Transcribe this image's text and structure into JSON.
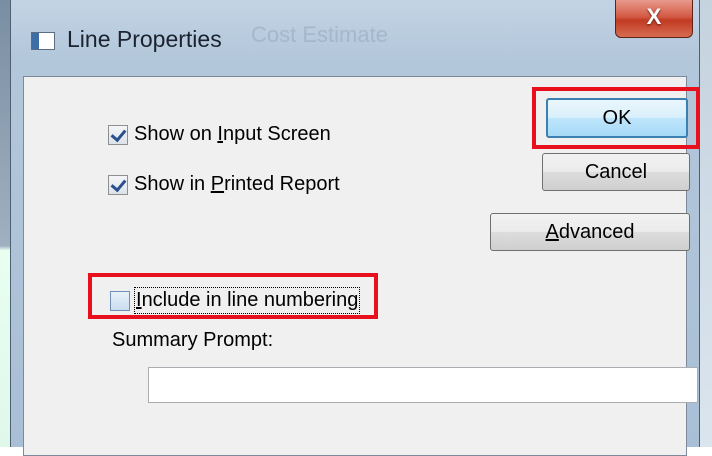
{
  "window": {
    "title": "Line Properties",
    "background_title": "Cost Estimate",
    "close_glyph": "X"
  },
  "checkboxes": {
    "show_input": {
      "pre": "Show on ",
      "accel": "I",
      "post": "nput Screen",
      "checked": true
    },
    "show_printed": {
      "pre": "Show in ",
      "accel": "P",
      "post": "rinted Report",
      "checked": true
    },
    "line_numbering": {
      "pre": "",
      "accel": "I",
      "post": "nclude in line numbering",
      "checked": false
    }
  },
  "buttons": {
    "ok": {
      "accel": "",
      "label": "OK"
    },
    "cancel": {
      "accel": "",
      "label": "Cancel"
    },
    "advanced": {
      "accel": "A",
      "label": "dvanced"
    }
  },
  "summary": {
    "label": "Summary Prompt:",
    "value": ""
  },
  "colors": {
    "highlight": "#e8101c",
    "default_button_border": "#3c7fb1",
    "close_button": "#c13b22"
  },
  "icons": [
    "window-app-icon",
    "close-icon",
    "checkmark-icon"
  ]
}
